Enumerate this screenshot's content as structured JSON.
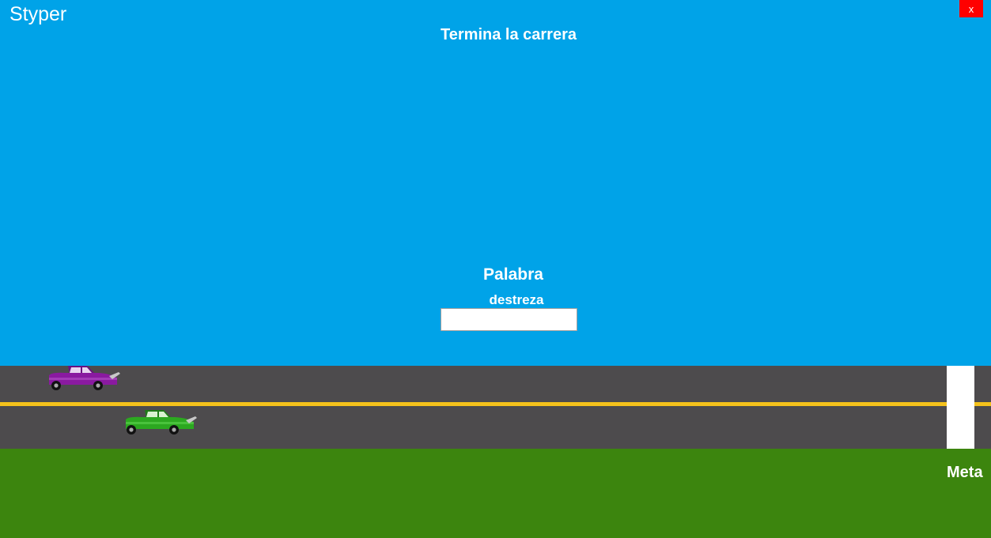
{
  "window": {
    "title": "Styper",
    "close_label": "x"
  },
  "game": {
    "instruction": "Termina la carrera",
    "word_label": "Palabra",
    "current_word": "destreza",
    "input": {
      "value": "",
      "placeholder": ""
    },
    "finish_label": "Meta"
  },
  "cars": [
    {
      "name": "purple-car",
      "color": "#8a1aa0",
      "lane": 1
    },
    {
      "name": "green-car",
      "color": "#2ca820",
      "lane": 2
    }
  ],
  "colors": {
    "sky": "#00a3e8",
    "road": "#4d4b4d",
    "lane_divider": "#f5c21c",
    "grass": "#3c850e",
    "close_button": "#ff0000"
  }
}
